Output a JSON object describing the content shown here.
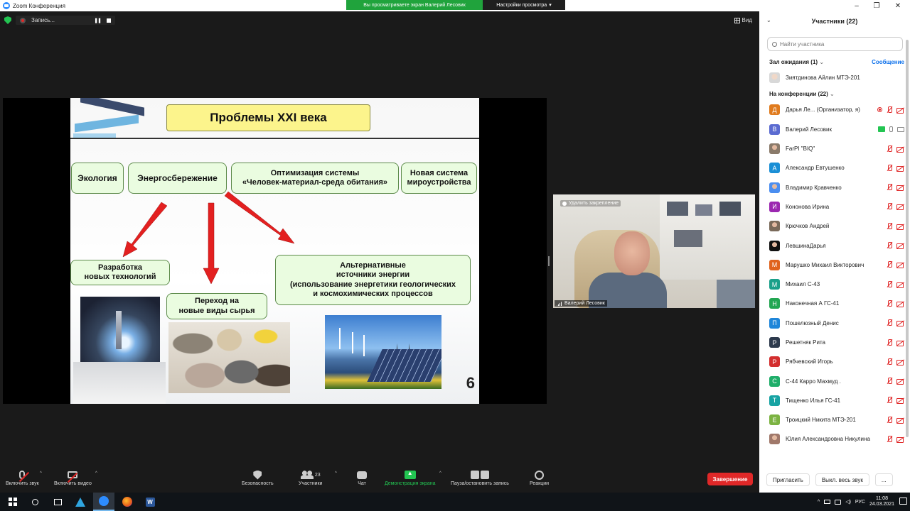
{
  "window": {
    "title": "Zoom Конференция",
    "banner": "Вы просматриваете экран Валерий Лесовик",
    "view_settings": "Настройки просмотра",
    "view_label": "Вид"
  },
  "recording": {
    "label": "Запись..."
  },
  "slide": {
    "title": "Проблемы XXI  века",
    "box_ecology": "Экология",
    "box_energy": "Энергосбережение",
    "box_opt_line1": "Оптимизация системы",
    "box_opt_line2": "«Человек-материал-среда обитания»",
    "box_new_line1": "Новая система",
    "box_new_line2": "мироустройства",
    "box_tech_line1": "Разработка",
    "box_tech_line2": "новых технологий",
    "box_raw_line1": "Переход на",
    "box_raw_line2": "новые виды сырья",
    "box_alt_line1": "Альтернативные",
    "box_alt_line2": "источники энергии",
    "box_alt_line3": "(использование энергетики геологических",
    "box_alt_line4": "и космохимических процессов",
    "slide_number": "6"
  },
  "video": {
    "unpin": "Удалить закрепление",
    "name": "Валерий Лесовик"
  },
  "toolbar": {
    "mute": "Включить звук",
    "video": "Включить видео",
    "security": "Безопасность",
    "participants": "Участники",
    "participants_count": "23",
    "chat": "Чат",
    "share": "Демонстрация экрана",
    "pause_record": "Пауза/остановить запись",
    "reactions": "Реакции",
    "end": "Завершение"
  },
  "panel": {
    "title": "Участники (22)",
    "search_placeholder": "Найти участника",
    "waiting_room": "Зал ожидания (1)",
    "message": "Сообщение",
    "waiting": [
      {
        "name": "Зиятдинова Айлин МТЭ-201"
      }
    ],
    "in_meeting": "На конференции (22)",
    "participants": [
      {
        "initial": "Д",
        "color": "#e07b1e",
        "name": "Дарья Ле... (Организатор, я)"
      },
      {
        "initial": "В",
        "color": "#5b6bd1",
        "name": "Валерий Лесовик"
      },
      {
        "initial": "",
        "color": "#8a7a6a",
        "name": "FarPI \"BIQ\""
      },
      {
        "initial": "А",
        "color": "#1a8fd6",
        "name": "Александр Евтушенко"
      },
      {
        "initial": "",
        "color": "#4a8ef0",
        "name": "Владимир Кравченко"
      },
      {
        "initial": "И",
        "color": "#9b27b0",
        "name": "Кононова Ирина"
      },
      {
        "initial": "",
        "color": "#7a6a5a",
        "name": "Крючков Андрей"
      },
      {
        "initial": "",
        "color": "#111111",
        "name": "ЛевшинаДарья"
      },
      {
        "initial": "М",
        "color": "#e0631e",
        "name": "Марушко Михаил Викторович"
      },
      {
        "initial": "М",
        "color": "#1aa08a",
        "name": "Михаил С-43"
      },
      {
        "initial": "Н",
        "color": "#22a652",
        "name": "Наконечная А ГС-41"
      },
      {
        "initial": "П",
        "color": "#1f86d9",
        "name": "Пошелюзный Денис"
      },
      {
        "initial": "Р",
        "color": "#2d3a4d",
        "name": "Решетняк Рита"
      },
      {
        "initial": "Р",
        "color": "#d32f2f",
        "name": "Рябчевский Игорь"
      },
      {
        "initial": "С",
        "color": "#1fae6a",
        "name": "С-44 Карро Махмуд ."
      },
      {
        "initial": "Т",
        "color": "#17a3a3",
        "name": "Тищенко Илья ГС-41"
      },
      {
        "initial": "Е",
        "color": "#7cb342",
        "name": "Троицкий Никита МТЭ-201"
      },
      {
        "initial": "",
        "color": "#a0786a",
        "name": "Юлия Александровна Никулина"
      }
    ],
    "invite": "Пригласить",
    "mute_all": "Выкл. весь звук",
    "more": "..."
  },
  "taskbar": {
    "lang": "РУС",
    "time": "11:08",
    "date": "24.03.2021"
  },
  "colors": {
    "zoom_blue": "#2d8cff",
    "share_green": "#20a33c",
    "end_red": "#e02828",
    "slide_yellow": "#fcf48c",
    "slide_green": "#eafce0",
    "arrow_red": "#e32020"
  }
}
